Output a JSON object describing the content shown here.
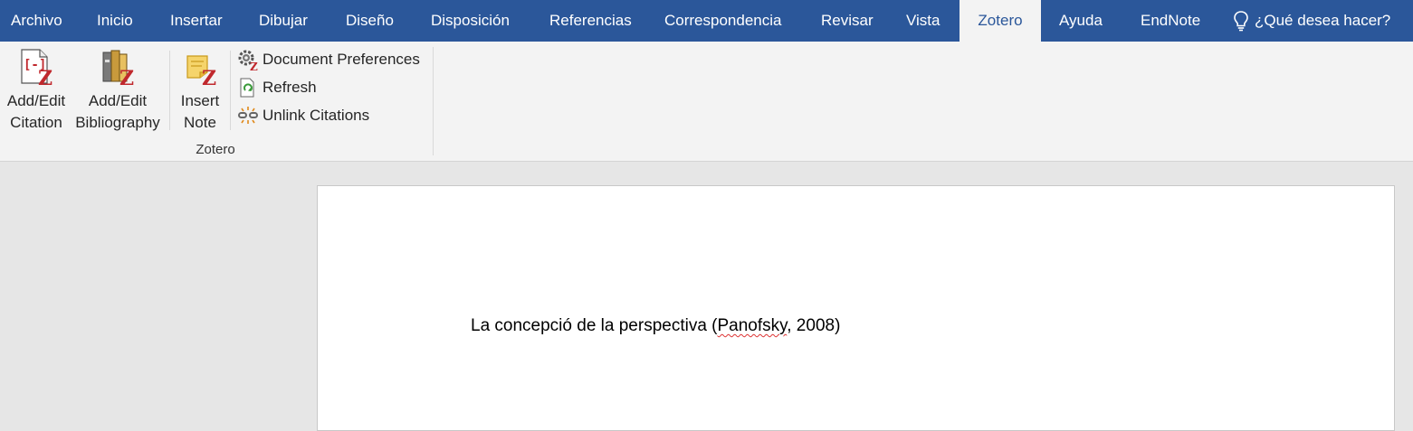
{
  "menu": {
    "tabs": [
      "Archivo",
      "Inicio",
      "Insertar",
      "Dibujar",
      "Diseño",
      "Disposición",
      "Referencias",
      "Correspondencia",
      "Revisar",
      "Vista",
      "Zotero",
      "Ayuda",
      "EndNote"
    ],
    "active_tab": "Zotero",
    "tell_me": "¿Qué desea hacer?"
  },
  "ribbon": {
    "add_edit_citation": [
      "Add/Edit",
      "Citation"
    ],
    "add_edit_bibliography": [
      "Add/Edit",
      "Bibliography"
    ],
    "insert_note": [
      "Insert",
      "Note"
    ],
    "document_preferences": "Document Preferences",
    "refresh": "Refresh",
    "unlink_citations": "Unlink Citations",
    "group_label": "Zotero"
  },
  "document": {
    "text_before": "La concepció de la perspectiva (",
    "citation_author": "Panofsky",
    "text_after": ", 2008)"
  },
  "colors": {
    "titlebar": "#2b579a",
    "ribbon_bg": "#f3f3f3",
    "zotero_red": "#c0282d"
  }
}
